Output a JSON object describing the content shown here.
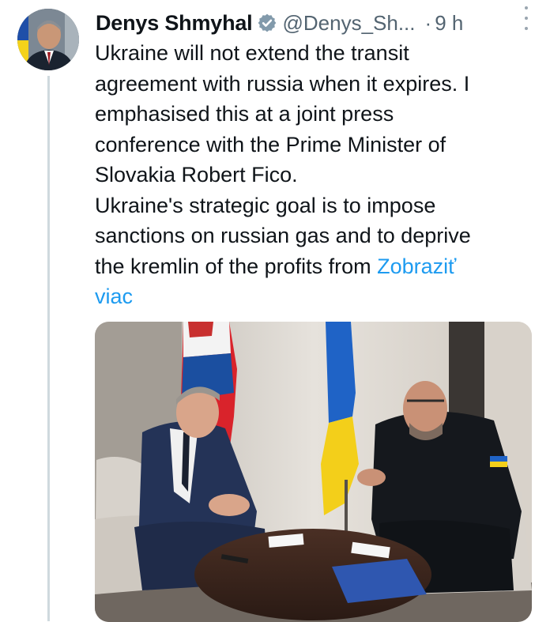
{
  "post": {
    "author_name": "Denys Shmyhal",
    "handle": "@Denys_Sh...",
    "separator": "·",
    "time": "9 h",
    "text": "Ukraine will not extend the transit\nagreement with russia when it expires. I\nemphasised this at a joint press\nconference with the Prime Minister of\nSlovakia Robert Fico.\nUkraine's strategic goal is to impose\nsanctions on russian gas and to deprive\nthe kremlin of the profits from ",
    "show_more": "Zobraziť\nviac"
  },
  "icons": {
    "verified": "verified-badge-icon",
    "more": "more-options-icon"
  },
  "colors": {
    "link": "#1d9bf0",
    "secondary_text": "#536471",
    "thread_line": "#cfd9de"
  }
}
